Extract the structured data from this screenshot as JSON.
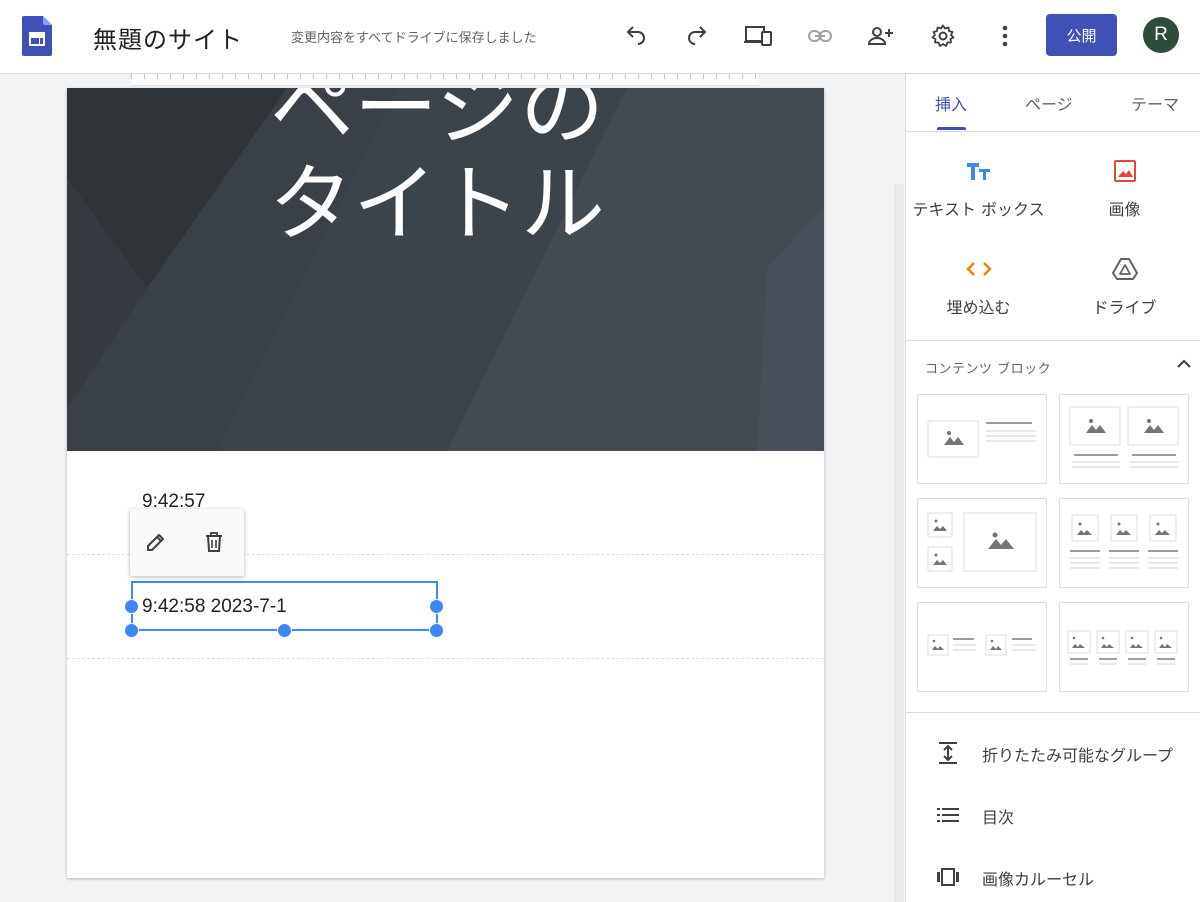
{
  "topbar": {
    "doc_title": "無題のサイト",
    "save_status": "変更内容をすべてドライブに保存しました",
    "publish_label": "公開",
    "avatar_letter": "R"
  },
  "page": {
    "header_title": "ページのタイトル",
    "text_block_1": "9:42:57",
    "text_block_2": "9:42:58 2023-7-1"
  },
  "side_panel": {
    "tabs": [
      {
        "label": "挿入",
        "active": true
      },
      {
        "label": "ページ",
        "active": false
      },
      {
        "label": "テーマ",
        "active": false
      }
    ],
    "insert_items": [
      {
        "label": "テキスト ボックス",
        "icon": "text-box-icon",
        "color": "#4285f4"
      },
      {
        "label": "画像",
        "icon": "image-icon",
        "color": "#e8453c"
      },
      {
        "label": "埋め込む",
        "icon": "embed-code-icon",
        "color": "#f57c00"
      },
      {
        "label": "ドライブ",
        "icon": "drive-icon",
        "color": "#5f6368"
      }
    ],
    "content_blocks_label": "コンテンツ ブロック",
    "list_items": [
      {
        "label": "折りたたみ可能なグループ",
        "icon": "collapsible-group-icon"
      },
      {
        "label": "目次",
        "icon": "table-of-contents-icon"
      },
      {
        "label": "画像カルーセル",
        "icon": "image-carousel-icon"
      }
    ]
  },
  "colors": {
    "accent": "#3f51b5",
    "selection": "#4285f4",
    "header_bg": "#3a4249"
  }
}
